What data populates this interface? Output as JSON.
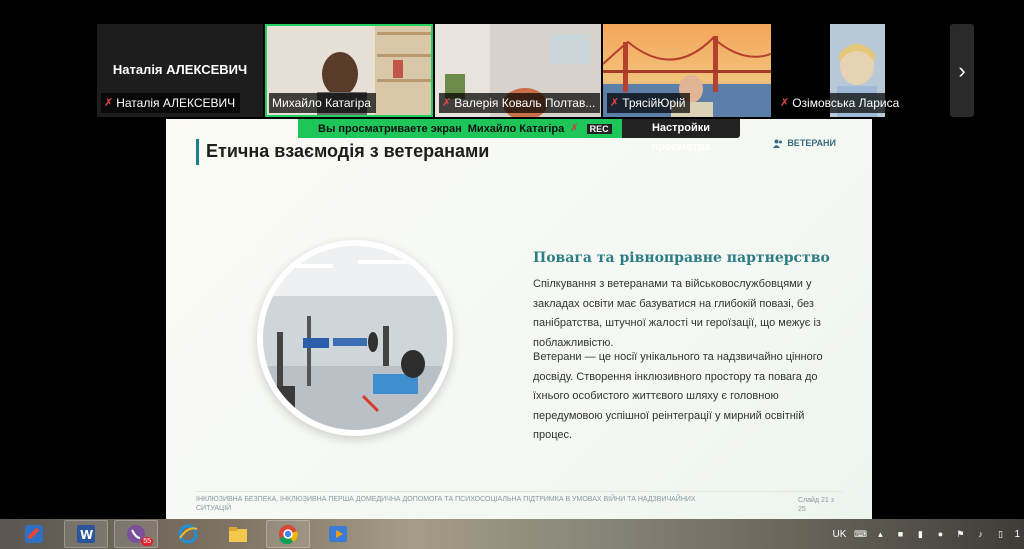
{
  "participants": [
    {
      "display_big": "Наталія АЛЕКСЕВИЧ",
      "label": "Наталія АЛЕКСЕВИЧ",
      "muted": true
    },
    {
      "label": "Михайло Катагіра",
      "muted": false,
      "active": true
    },
    {
      "label": "Валерія Коваль Полтав...",
      "muted": true
    },
    {
      "label": "ТрясійЮрій",
      "muted": true
    },
    {
      "label": "Озімовська Лариса",
      "muted": true
    }
  ],
  "share_bar": {
    "viewing_text": "Вы просматриваете экран",
    "presenter": "Михайло Катагіра",
    "rec": "REC",
    "view_settings": "Настройки просмотра"
  },
  "slide": {
    "title": "Етична взаємодія з ветеранами",
    "tag": "ВЕТЕРАНИ",
    "heading": "Повага та рівноправне партнерство",
    "paragraph1": "Спілкування з ветеранами та військовослужбовцями у закладах освіти має базуватися на глибокій повазі, без панібратства, штучної жалості чи героїзації, що межує із поблажливістю.",
    "paragraph2": "Ветерани — це носії унікального та надзвичайно цінного досвіду. Створення інклюзивного простору та повага до їхнього особистого життєвого шляху є головною передумовою успішної реінтеграції у мирний освітній процес.",
    "footer": "ІНКЛЮЗИВНА БЕЗПЕКА, ІНКЛЮЗИВНА ПЕРША ДОМЕДИЧНА ДОПОМОГА ТА ПСИХОСОЦІАЛЬНА ПІДТРИМКА В УМОВАХ ВІЙНИ ТА НАДЗВИЧАЙНИХ СИТУАЦІЙ",
    "slide_number": "Слайд 21 з 25"
  },
  "taskbar": {
    "apps": [
      "magnet-app-icon",
      "word-icon",
      "viber-icon",
      "internet-explorer-icon",
      "file-explorer-icon",
      "chrome-icon",
      "media-player-icon"
    ],
    "viber_badge": "55"
  },
  "tray": {
    "language": "UK",
    "clock_partial": "1"
  },
  "colors": {
    "accent_green": "#1ec65a",
    "slide_teal": "#2e7d86",
    "muted_red": "#e0463f"
  }
}
